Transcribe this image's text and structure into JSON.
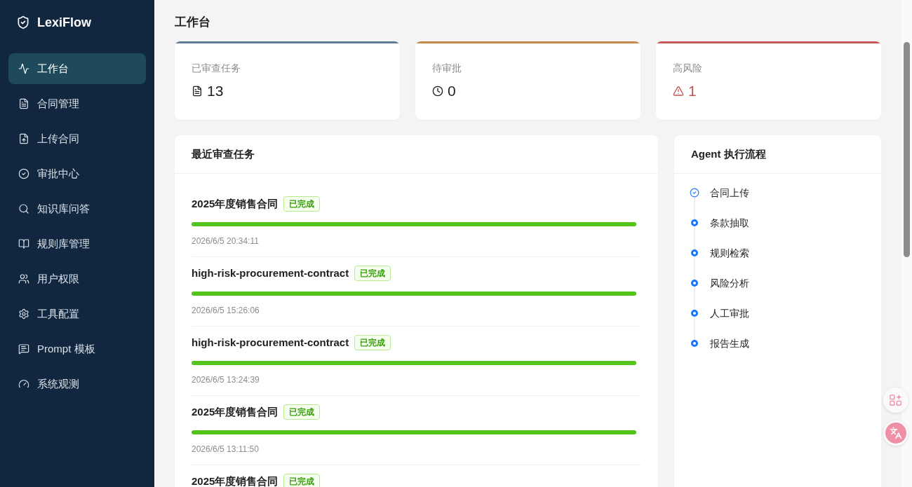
{
  "sidebar": {
    "brand": "LexiFlow",
    "items": [
      {
        "label": "工作台",
        "selected": true
      },
      {
        "label": "合同管理",
        "selected": false
      },
      {
        "label": "上传合同",
        "selected": false
      },
      {
        "label": "审批中心",
        "selected": false
      },
      {
        "label": "知识库问答",
        "selected": false
      },
      {
        "label": "规则库管理",
        "selected": false
      },
      {
        "label": "用户权限",
        "selected": false
      },
      {
        "label": "工具配置",
        "selected": false
      },
      {
        "label": "Prompt 模板",
        "selected": false
      },
      {
        "label": "系统观测",
        "selected": false
      }
    ]
  },
  "page_title": "工作台",
  "stats": [
    {
      "kind": "reviewed",
      "label": "已审查任务",
      "value": "13",
      "color": "#5f7b96"
    },
    {
      "kind": "pending",
      "label": "待审批",
      "value": "0",
      "color": "#c48a4c"
    },
    {
      "kind": "risk",
      "label": "高风险",
      "value": "1",
      "color": "#c25a5a"
    }
  ],
  "recent_tasks": {
    "title": "最近审查任务",
    "items": [
      {
        "name": "2025年度销售合同",
        "status": "已完成",
        "level": 1,
        "time": "2026/6/5 20:34:11"
      },
      {
        "name": "high-risk-procurement-contract",
        "status": "已完成",
        "level": 1,
        "time": "2026/6/5 15:26:06"
      },
      {
        "name": "high-risk-procurement-contract",
        "status": "已完成",
        "level": 1,
        "time": "2026/6/5 13:24:39"
      },
      {
        "name": "2025年度销售合同",
        "status": "已完成",
        "level": 1,
        "time": "2026/6/5 13:11:50"
      },
      {
        "name": "2025年度销售合同",
        "status": "已完成"
      }
    ]
  },
  "workflow": {
    "title": "Agent 执行流程",
    "steps": [
      {
        "label": "合同上传",
        "done": true
      },
      {
        "label": "条款抽取",
        "done": false
      },
      {
        "label": "规则检索",
        "done": false
      },
      {
        "label": "风险分析",
        "done": false
      },
      {
        "label": "人工审批",
        "done": false
      },
      {
        "label": "报告生成",
        "done": false
      }
    ]
  }
}
